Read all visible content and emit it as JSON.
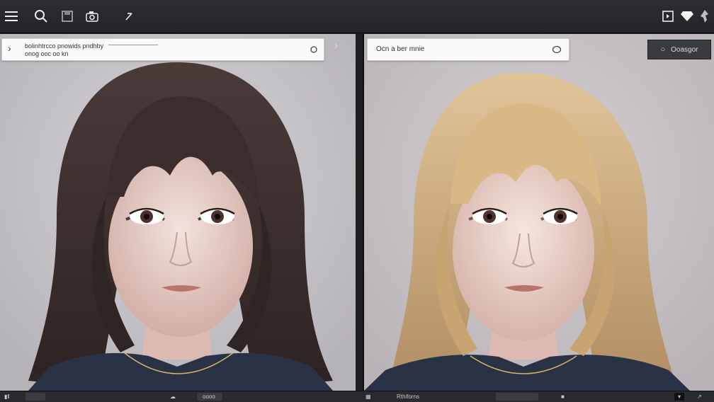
{
  "toolbar": {
    "left_icons": [
      "menu-icon",
      "search-icon",
      "save-icon",
      "camera-icon",
      "undo-icon"
    ],
    "right_icons": [
      "panel-icon",
      "gem-icon",
      "pin-icon"
    ]
  },
  "left_panel": {
    "prompt_line1": "bolinhtrcco pnowids pndhby",
    "prompt_line2": "onog ooc oo kn"
  },
  "right_panel": {
    "prompt_text": "Ocn a ber mnie",
    "compare_label": "Ooasgor"
  },
  "statusbar": {
    "left_text": "Rthiforns",
    "mid_text": "oooo"
  },
  "colors": {
    "dark_hair": "#3a2d2b",
    "blonde_hair": "#d7b68a",
    "background": "#c6c3c7",
    "sweater": "#2a3345"
  }
}
